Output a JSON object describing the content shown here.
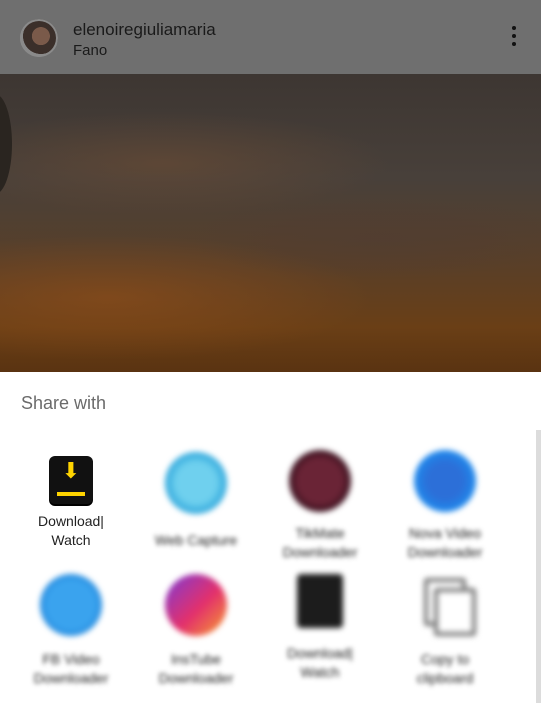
{
  "post": {
    "username": "elenoiregiuliamaria",
    "location": "Fano"
  },
  "share_sheet": {
    "title": "Share with",
    "apps": [
      {
        "label": "Download|\nWatch",
        "icon": "download-watch-icon",
        "blurred": false
      },
      {
        "label": "Web Capture",
        "icon": "web-capture-icon",
        "blurred": true
      },
      {
        "label": "TikMate\nDownloader",
        "icon": "tikmate-icon",
        "blurred": true
      },
      {
        "label": "Nova Video\nDownloader",
        "icon": "nova-video-icon",
        "blurred": true
      },
      {
        "label": "FB Video\nDownloader",
        "icon": "fb-video-icon",
        "blurred": true
      },
      {
        "label": "InsTube\nDownloader",
        "icon": "instube-icon",
        "blurred": true
      },
      {
        "label": "Download|\nWatch",
        "icon": "download-watch-icon",
        "blurred": true
      },
      {
        "label": "Copy to\nclipboard",
        "icon": "copy-icon",
        "blurred": true
      }
    ]
  },
  "colors": {
    "sheet_bg": "#ffffff",
    "dim_overlay": "#6f6f6f",
    "download_accent": "#ffd400"
  }
}
